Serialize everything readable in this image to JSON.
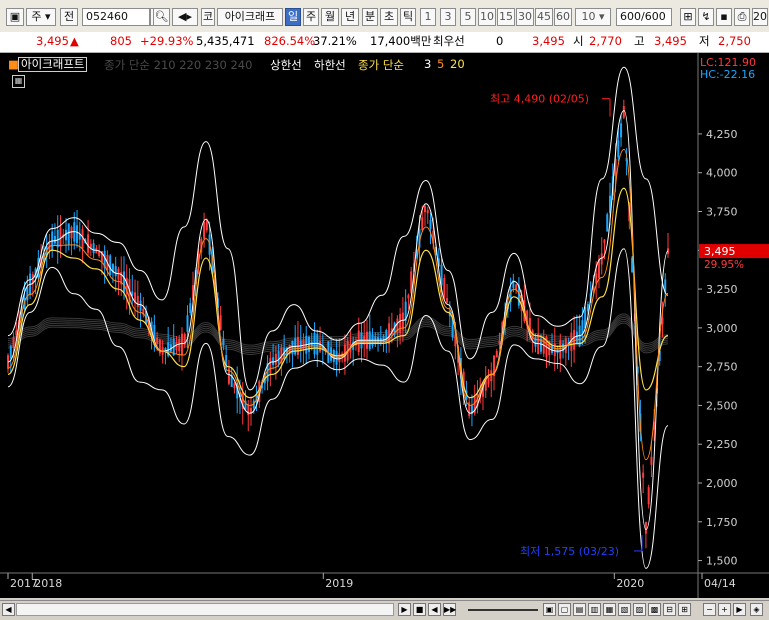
{
  "toolbar": {
    "type_label": "주",
    "prev_label": "전",
    "code": "052460",
    "name": "아이크래프",
    "name_prefix": "코",
    "periods": [
      "일",
      "주",
      "월",
      "년",
      "분",
      "초",
      "틱"
    ],
    "active_period": "일",
    "intervals": [
      "1",
      "3",
      "5",
      "10",
      "15",
      "30",
      "45",
      "60"
    ],
    "interval_value": "10",
    "count": "600/600",
    "extra_label": "20"
  },
  "quote": {
    "price": "3,495",
    "change": "805",
    "change_pct": "+29.93%",
    "volume": "5,435,471",
    "volume_ratio": "826.54%",
    "turnover": "37.21%",
    "amount": "17,400백만",
    "preferred_label": "최우선",
    "preferred_value": "0",
    "cur_price": "3,495",
    "open_label": "시",
    "open": "2,770",
    "high_label": "고",
    "high": "3,495",
    "low_label": "저",
    "low": "2,750"
  },
  "legend": {
    "stock": "아이크래프트",
    "ma_dim": "종가 단순 210 220 230 240",
    "band_upper": "상한선",
    "band_lower": "하한선",
    "ma_label": "종가 단순",
    "ma1": "3",
    "ma2": "5",
    "ma3": "20"
  },
  "corner": {
    "lc": "LC:121.90",
    "hc": "HC:-22.16"
  },
  "chart_data": {
    "type": "line",
    "title": "아이크래프트",
    "y_ticks": [
      1500,
      1750,
      2000,
      2250,
      2500,
      2750,
      3000,
      3250,
      3500,
      3750,
      4000,
      4250
    ],
    "y_tick_labels": [
      "1,500",
      "1,750",
      "2,000",
      "2,250",
      "2,500",
      "2,750",
      "3,000",
      "3,250",
      "3,500",
      "3,750",
      "4,000",
      "4,250"
    ],
    "ylim": [
      1420,
      4720
    ],
    "x_labels": [
      "2017",
      "2018",
      "2019",
      "2020",
      "04/14"
    ],
    "x_label_dates": [
      "2017-12",
      "2018-01",
      "2019-01",
      "2020-01",
      "2020-04-14"
    ],
    "x_range": [
      "2017-12",
      "2020-04"
    ],
    "last_price": 3495,
    "last_label": "3,495",
    "last_change_label": "29.95%",
    "high_marker": {
      "label": "최고 4,490 (02/05)",
      "value": 4490
    },
    "low_marker": {
      "label": "최저 1,575 (03/23)",
      "value": 1575
    },
    "colors": {
      "up": "#ff3b3b",
      "down": "#1aa8ff",
      "ma3": "#ffffff",
      "ma5": "#ff8c1a",
      "ma20": "#ffe14d",
      "band": "#ffffff",
      "high": "#ff2020",
      "low": "#2040ff"
    },
    "series": [
      {
        "name": "상한선",
        "values": [
          2950,
          3310,
          3640,
          3710,
          3610,
          3550,
          3370,
          3180,
          3650,
          4200,
          3510,
          2600,
          2980,
          3150,
          2980,
          2920,
          3030,
          3210,
          3590,
          3950,
          3370,
          2800,
          3100,
          3480,
          3080,
          3010,
          3070,
          3960,
          4680,
          3960,
          3210
        ]
      },
      {
        "name": "하한선",
        "values": [
          2620,
          3100,
          3390,
          3220,
          3120,
          2880,
          2650,
          2600,
          2380,
          2900,
          2300,
          2180,
          2540,
          2740,
          2790,
          2730,
          2800,
          2760,
          2650,
          3080,
          2850,
          2280,
          2410,
          2890,
          2800,
          2770,
          2640,
          2880,
          3510,
          1450,
          2370
        ]
      },
      {
        "name": "3",
        "values": [
          2780,
          3280,
          3560,
          3620,
          3500,
          3350,
          3150,
          2850,
          2900,
          3700,
          2700,
          2450,
          2780,
          2880,
          2900,
          2800,
          2920,
          2920,
          3050,
          3800,
          3150,
          2450,
          2700,
          3300,
          2900,
          2850,
          2950,
          3450,
          4400,
          1700,
          3495
        ]
      },
      {
        "name": "20",
        "values": [
          2700,
          3150,
          3500,
          3450,
          3380,
          3250,
          3050,
          2850,
          2750,
          3450,
          2750,
          2550,
          2700,
          2850,
          2870,
          2820,
          2900,
          2900,
          2950,
          3500,
          3100,
          2550,
          2700,
          3200,
          2950,
          2880,
          2900,
          3200,
          3900,
          2600,
          2950
        ]
      }
    ]
  },
  "scrollbar": {
    "left_icon": "scroll-left-icon",
    "right_icon": "scroll-right-icon"
  }
}
